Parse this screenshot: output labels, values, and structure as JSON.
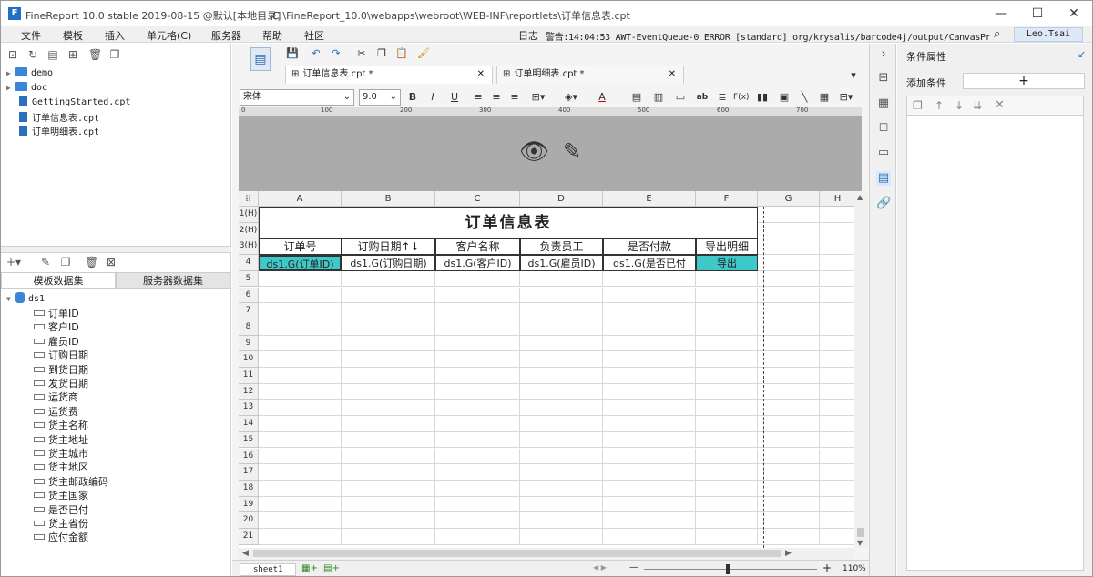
{
  "title_bar": {
    "app_title": "FineReport 10.0 stable 2019-08-15 @默认[本地目录]",
    "file_path": "C:\\FineReport_10.0\\webapps\\webroot\\WEB-INF\\reportlets\\订单信息表.cpt",
    "logo": "F",
    "minimize": "—",
    "maximize": "☐",
    "close": "✕"
  },
  "menu": {
    "items": [
      "文件",
      "模板",
      "插入",
      "单元格(C)",
      "服务器",
      "帮助",
      "社区"
    ],
    "log_label": "日志",
    "log_message": "警告:14:04:53 AWT-EventQueue-0 ERROR [standard] org/krysalis/barcode4j/output/CanvasProvider",
    "user": "Leo.Tsai"
  },
  "file_tree": {
    "items": [
      {
        "label": "demo",
        "type": "folder"
      },
      {
        "label": "doc",
        "type": "folder"
      },
      {
        "label": "GettingStarted.cpt",
        "type": "file"
      },
      {
        "label": "订单信息表.cpt",
        "type": "file"
      },
      {
        "label": "订单明细表.cpt",
        "type": "file"
      }
    ]
  },
  "dataset_panel": {
    "tabs": [
      "模板数据集",
      "服务器数据集"
    ],
    "dataset": "ds1",
    "fields": [
      "订单ID",
      "客户ID",
      "雇员ID",
      "订购日期",
      "到货日期",
      "发货日期",
      "运货商",
      "运货费",
      "货主名称",
      "货主地址",
      "货主城市",
      "货主地区",
      "货主邮政编码",
      "货主国家",
      "是否已付",
      "货主省份",
      "应付金额"
    ]
  },
  "tabs": [
    {
      "label": "订单信息表.cpt *",
      "close": "✕"
    },
    {
      "label": "订单明细表.cpt *",
      "close": "✕"
    }
  ],
  "format_bar": {
    "font": "宋体",
    "size": "9.0",
    "bold": "B",
    "italic": "I",
    "underline": "U",
    "text_a": "A",
    "ab": "ab",
    "fx": "F(x)"
  },
  "ruler": {
    "ticks": [
      "0",
      "100",
      "200",
      "300",
      "400",
      "500",
      "600",
      "700"
    ]
  },
  "grid": {
    "columns": [
      "A",
      "B",
      "C",
      "D",
      "E",
      "F",
      "G",
      "H"
    ],
    "rows": [
      "1(H)",
      "2(H)",
      "3(H)",
      "4",
      "5",
      "6",
      "7",
      "8",
      "9",
      "10",
      "11",
      "12",
      "13",
      "14",
      "15",
      "16",
      "17",
      "18",
      "19",
      "20",
      "21"
    ],
    "report_title": "订单信息表",
    "headers": [
      "订单号",
      "订购日期↑↓",
      "客户名称",
      "负责员工",
      "是否付款",
      "导出明细"
    ],
    "data_row": [
      "ds1.G(订单ID)",
      "ds1.G(订购日期)",
      "ds1.G(客户ID)",
      "ds1.G(雇员ID)",
      "ds1.G(是否已付",
      "导出"
    ]
  },
  "status": {
    "sheet": "sheet1",
    "zoom": "110%",
    "minus": "—",
    "plus": "+"
  },
  "right_panel": {
    "title": "条件属性",
    "add_condition_label": "添加条件",
    "add_button": "+"
  },
  "colors": {
    "accent": "#2a6fc0",
    "teal_cell": "#3fc8c8",
    "header_gray": "#ababab"
  },
  "icons": [
    "save-icon",
    "undo-icon",
    "redo-icon",
    "cut-icon",
    "copy-icon",
    "paste-icon",
    "brush-icon",
    "hide-icon",
    "edit-icon"
  ]
}
